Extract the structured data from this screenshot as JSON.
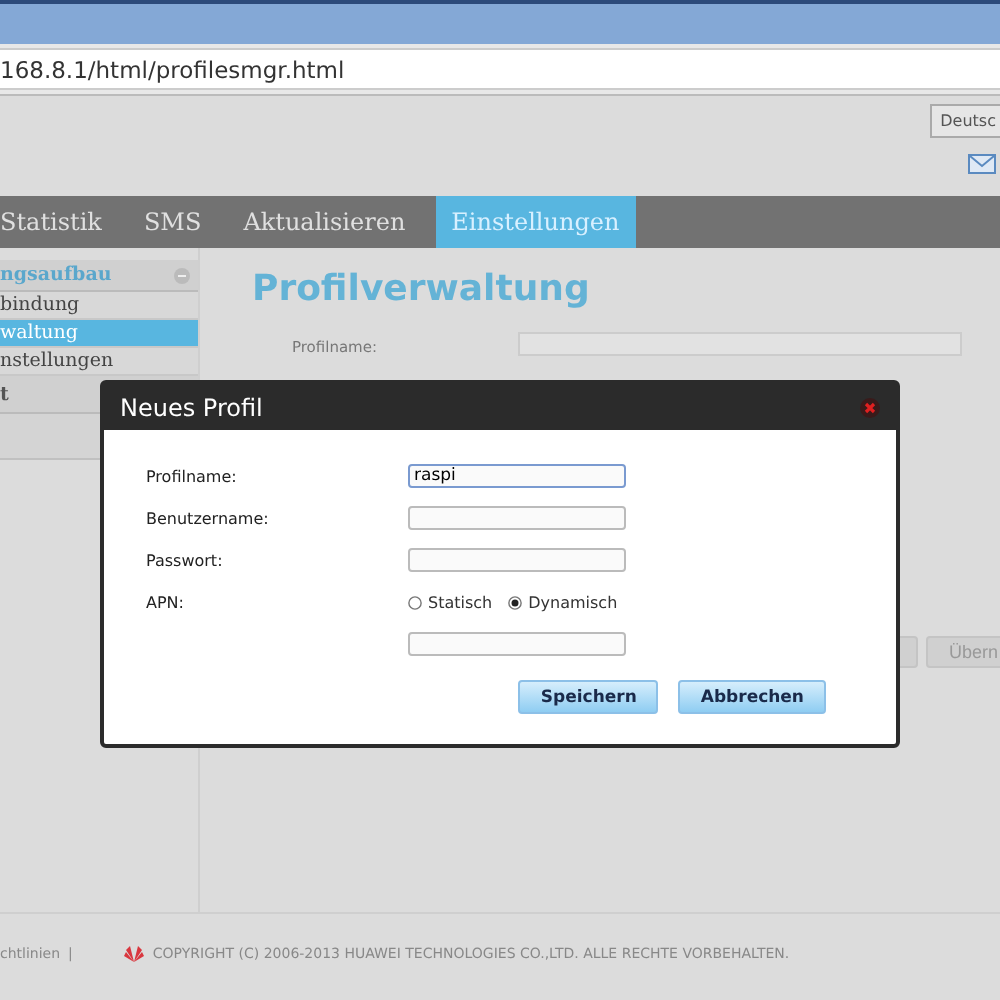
{
  "browser": {
    "address": "168.8.1/html/profilesmgr.html"
  },
  "header": {
    "language": "Deutsc"
  },
  "nav": [
    {
      "label": "Statistik",
      "selected": false
    },
    {
      "label": "SMS",
      "selected": false
    },
    {
      "label": "Aktualisieren",
      "selected": false
    },
    {
      "label": "Einstellungen",
      "selected": true
    }
  ],
  "sidebar": [
    {
      "kind": "section",
      "label": "ngsaufbau"
    },
    {
      "kind": "link",
      "label": "bindung",
      "selected": false
    },
    {
      "kind": "link",
      "label": "waltung",
      "selected": true
    },
    {
      "kind": "link",
      "label": "nstellungen",
      "selected": false
    },
    {
      "kind": "section",
      "label": "t"
    }
  ],
  "page": {
    "title": "Profilverwaltung",
    "field_label": "Profilname:",
    "button": "Übern"
  },
  "dialog": {
    "title": "Neues Profil",
    "fields": [
      {
        "kind": "text",
        "label": "Profilname:",
        "value": "raspi"
      },
      {
        "kind": "text",
        "label": "Benutzername:"
      },
      {
        "kind": "password",
        "label": "Passwort:"
      },
      {
        "kind": "radio",
        "label": "APN:",
        "options": [
          {
            "label": "Statisch",
            "selected": false
          },
          {
            "label": "Dynamisch",
            "selected": true
          }
        ]
      }
    ],
    "buttons": [
      "Speichern",
      "Abbrechen"
    ]
  },
  "footer": {
    "link": "chtlinien",
    "separator": "|",
    "copyright": "COPYRIGHT (C) 2006-2013 HUAWEI TECHNOLOGIES CO.,LTD. ALLE RECHTE VORBEHALTEN."
  }
}
